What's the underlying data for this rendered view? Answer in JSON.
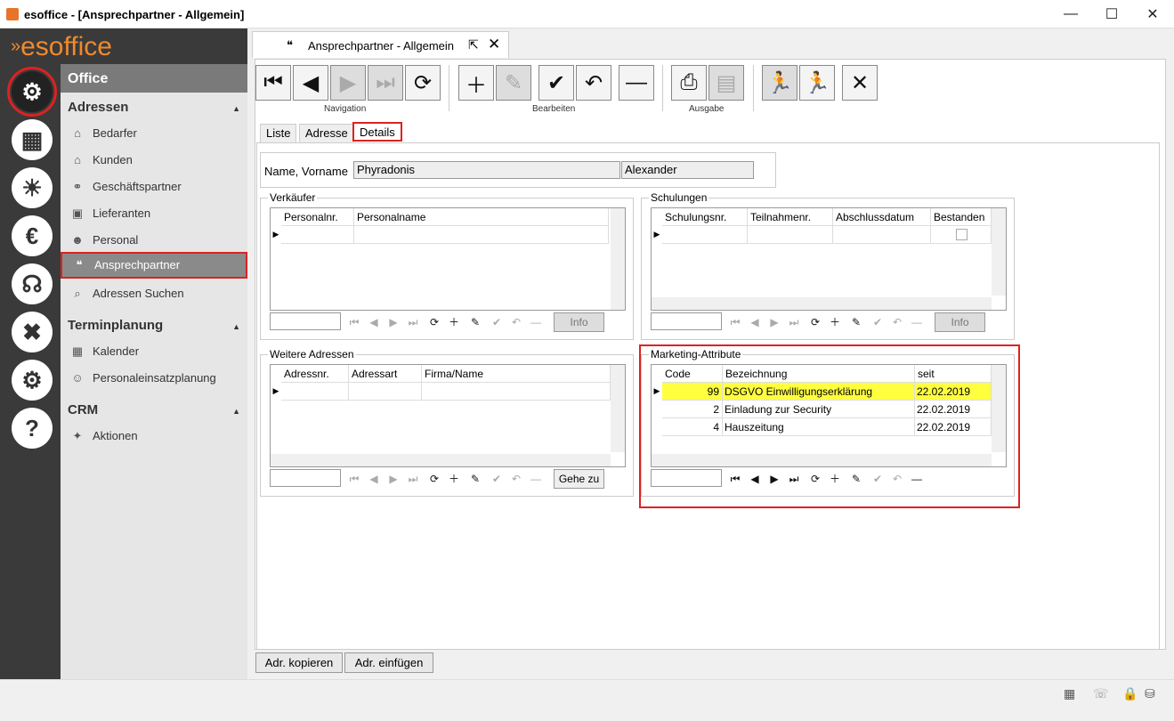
{
  "window": {
    "title": "esoffice - [Ansprechpartner - Allgemein]",
    "min": "—",
    "max": "☐",
    "close": "✕"
  },
  "logo": "esoffice",
  "nav": {
    "office": "Office",
    "sections": [
      {
        "label": "Adressen"
      },
      {
        "label": "Terminplanung"
      },
      {
        "label": "CRM"
      }
    ],
    "items": [
      {
        "label": "Bedarfer"
      },
      {
        "label": "Kunden"
      },
      {
        "label": "Geschäftspartner"
      },
      {
        "label": "Lieferanten"
      },
      {
        "label": "Personal"
      },
      {
        "label": "Ansprechpartner"
      },
      {
        "label": "Adressen Suchen"
      },
      {
        "label": "Kalender"
      },
      {
        "label": "Personaleinsatzplanung"
      },
      {
        "label": "Aktionen"
      }
    ]
  },
  "doc_tab": {
    "label": "Ansprechpartner - Allgemein"
  },
  "toolbar": {
    "groups": [
      "Navigation",
      "Bearbeiten",
      "Ausgabe"
    ]
  },
  "tabs": [
    "Liste",
    "Adresse",
    "Details"
  ],
  "name": {
    "label": "Name, Vorname",
    "last": "Phyradonis",
    "first": "Alexander"
  },
  "verkaeufer": {
    "title": "Verkäufer",
    "cols": [
      "Personalnr.",
      "Personalname"
    ],
    "info": "Info"
  },
  "schulungen": {
    "title": "Schulungen",
    "cols": [
      "Schulungsnr.",
      "Teilnahmenr.",
      "Abschlussdatum",
      "Bestanden"
    ],
    "info": "Info"
  },
  "weitere": {
    "title": "Weitere Adressen",
    "cols": [
      "Adressnr.",
      "Adressart",
      "Firma/Name"
    ],
    "goto": "Gehe zu"
  },
  "marketing": {
    "title": "Marketing-Attribute",
    "cols": [
      "Code",
      "Bezeichnung",
      "seit"
    ],
    "rows": [
      {
        "code": "99",
        "bez": "DSGVO Einwilligungserklärung",
        "seit": "22.02.2019"
      },
      {
        "code": "2",
        "bez": "Einladung zur Security",
        "seit": "22.02.2019"
      },
      {
        "code": "4",
        "bez": "Hauszeitung",
        "seit": "22.02.2019"
      }
    ]
  },
  "bottom": {
    "copy": "Adr. kopieren",
    "paste": "Adr. einfügen"
  },
  "colors": {
    "accent": "#f08a2c",
    "highlight": "#ffff40",
    "selection_border": "#dd2222"
  }
}
